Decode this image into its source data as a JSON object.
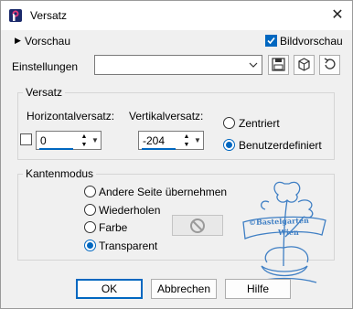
{
  "window": {
    "title": "Versatz"
  },
  "top": {
    "preview_toggle": "Vorschau",
    "bildvorschau": "Bildvorschau",
    "bildvorschau_checked": true
  },
  "settings": {
    "label": "Einstellungen",
    "value": ""
  },
  "offset_group": {
    "title": "Versatz",
    "horizontal_label": "Horizontalversatz:",
    "vertical_label": "Vertikalversatz:",
    "horizontal_value": "0",
    "vertical_value": "-204",
    "centered": "Zentriert",
    "custom": "Benutzerdefiniert",
    "selected": "custom"
  },
  "edge_group": {
    "title": "Kantenmodus",
    "options": [
      "Andere Seite übernehmen",
      "Wiederholen",
      "Farbe",
      "Transparent"
    ],
    "selected": "Transparent"
  },
  "watermark": {
    "line1": "©Bastelgarten",
    "line2": "Wien"
  },
  "buttons": {
    "ok": "OK",
    "cancel": "Abbrechen",
    "help": "Hilfe"
  },
  "colors": {
    "accent": "#0067c0",
    "watermark": "#3f7fc4"
  }
}
